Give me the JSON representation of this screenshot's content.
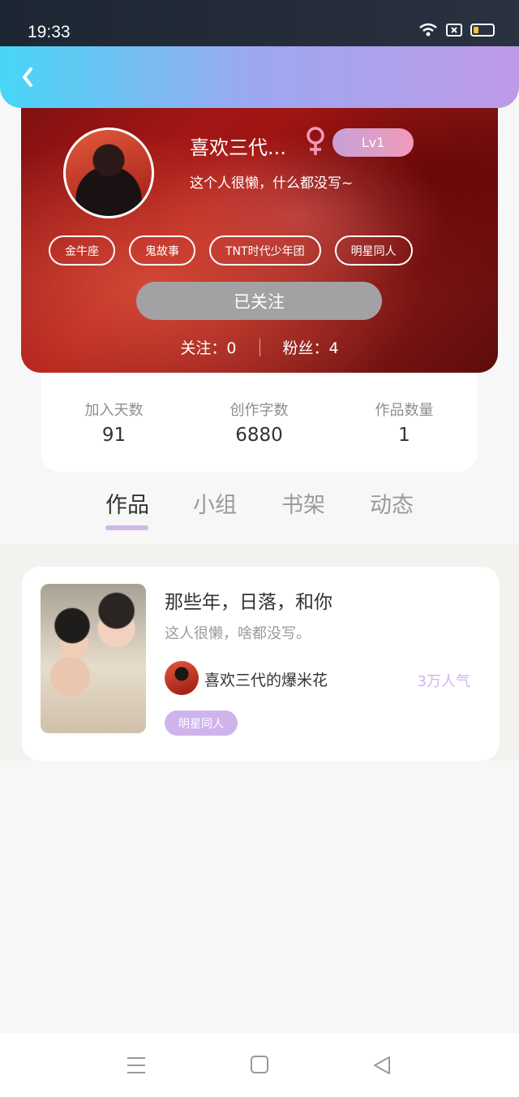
{
  "status_bar": {
    "time": "19:33",
    "icons": [
      "wifi-icon",
      "sim-icon",
      "battery-icon"
    ],
    "battery_color": "#f3c43b"
  },
  "nav": {
    "back_icon": "chevron-left-icon"
  },
  "profile": {
    "name": "喜欢三代...",
    "gender_icon": "female-icon",
    "gender_color": "#f29bb8",
    "level": "Lv1",
    "bio": "这个人很懒，什么都没写~",
    "tags": [
      "金牛座",
      "鬼故事",
      "TNT时代少年团",
      "明星同人"
    ],
    "follow_button": "已关注",
    "following_label": "关注：0",
    "fans_label": "粉丝：4"
  },
  "stats": [
    {
      "label": "加入天数",
      "value": "91"
    },
    {
      "label": "创作字数",
      "value": "6880"
    },
    {
      "label": "作品数量",
      "value": "1"
    }
  ],
  "tabs": [
    {
      "label": "作品",
      "active": true
    },
    {
      "label": "小组",
      "active": false
    },
    {
      "label": "书架",
      "active": false
    },
    {
      "label": "动态",
      "active": false
    }
  ],
  "works": [
    {
      "title": "那些年，日落，和你",
      "description": "这人很懒，啥都没写。",
      "author": "喜欢三代的爆米花",
      "popularity": "3万人气",
      "tag": "明星同人"
    }
  ],
  "system_nav": {
    "icons": [
      "menu-icon",
      "home-icon",
      "back-triangle-icon"
    ]
  },
  "colors": {
    "accent": "#cfb4ec",
    "nav_gradient_start": "#47d6f6",
    "nav_gradient_end": "#be9ae7",
    "hero_red": "#b11a17"
  }
}
